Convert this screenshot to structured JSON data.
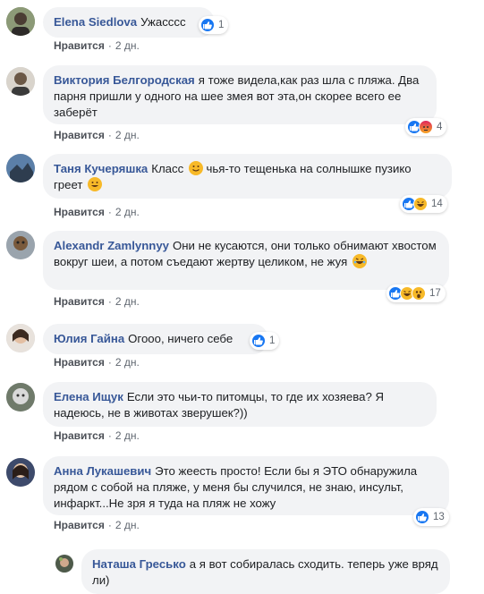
{
  "colors": {
    "author": "#385898",
    "bubble": "#f2f3f5",
    "meta": "#606770",
    "like_blue": "#1877f2",
    "angry": "#e9710f",
    "haha_yellow": "#f7b928"
  },
  "comments": [
    {
      "author": "Elena Siedlova",
      "text": "Ужасссс",
      "reactions": {
        "icons": [
          "like-icon"
        ],
        "count": "1"
      },
      "like_label": "Нравится",
      "dot": "·",
      "time": "2 дн."
    },
    {
      "author": "Виктория Белгородская",
      "text": "я тоже видела,как раз шла с пляжа. Два парня пришли у одного на шее змея вот эта,он скорее всего ее заберёт",
      "reactions": {
        "icons": [
          "like-icon",
          "angry-icon"
        ],
        "count": "4"
      },
      "like_label": "Нравится",
      "dot": "·",
      "time": "2 дн."
    },
    {
      "author": "Таня Кучеряшка",
      "text_parts": [
        "Класс",
        "чья-то тещенька на солнышке пузико греет"
      ],
      "reactions": {
        "icons": [
          "like-icon",
          "haha-icon"
        ],
        "count": "14"
      },
      "like_label": "Нравится",
      "dot": "·",
      "time": "2 дн."
    },
    {
      "author": "Alexandr Zamlynnyy",
      "text": "Они не кусаются, они только обнимают хвостом вокруг шеи, а потом съедают жертву целиком, не жуя",
      "reactions": {
        "icons": [
          "like-icon",
          "haha-icon",
          "wow-icon"
        ],
        "count": "17"
      },
      "like_label": "Нравится",
      "dot": "·",
      "time": "2 дн."
    },
    {
      "author": "Юлия Гайна",
      "text": "Огооо, ничего себе",
      "reactions": {
        "icons": [
          "like-icon"
        ],
        "count": "1"
      },
      "like_label": "Нравится",
      "dot": "·",
      "time": "2 дн."
    },
    {
      "author": "Елена Ищук",
      "text": "Если это чьи-то питомцы, то где их хозяева? Я надеюсь, не в животах зверушек?))",
      "like_label": "Нравится",
      "dot": "·",
      "time": "2 дн."
    },
    {
      "author": "Анна Лукашевич",
      "text": "Это жеесть просто! Если бы я ЭТО обнаружила рядом с собой на пляже, у меня бы случился, не знаю, инсульт, инфаркт...Не зря я туда на пляж не хожу",
      "reactions": {
        "icons": [
          "like-icon"
        ],
        "count": "13"
      },
      "like_label": "Нравится",
      "dot": "·",
      "time": "2 дн."
    }
  ],
  "reply": {
    "author": "Наташа Гресько",
    "text": "а я вот собиралась сходить. теперь уже вряд ли)"
  }
}
